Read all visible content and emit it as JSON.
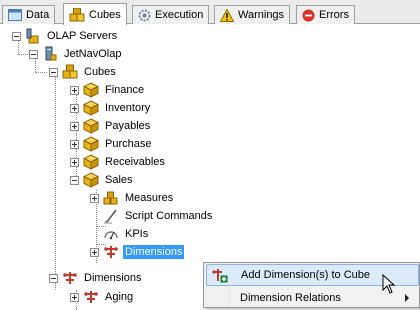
{
  "tabs": [
    {
      "label": "Data",
      "icon": "data-grid-icon",
      "active": false
    },
    {
      "label": "Cubes",
      "icon": "cubes-icon",
      "active": true
    },
    {
      "label": "Execution",
      "icon": "gear-icon",
      "active": false
    },
    {
      "label": "Warnings",
      "icon": "warning-icon",
      "active": false
    },
    {
      "label": "Errors",
      "icon": "error-icon",
      "active": false
    }
  ],
  "tree": {
    "olap_servers": "OLAP Servers",
    "server": "JetNavOlap",
    "cubes": "Cubes",
    "cube_items": [
      "Finance",
      "Inventory",
      "Payables",
      "Purchase",
      "Receivables"
    ],
    "sales": "Sales",
    "sales_children": {
      "measures": "Measures",
      "script_commands": "Script Commands",
      "kpis": "KPIs",
      "dimensions": "Dimensions"
    },
    "dimensions": "Dimensions",
    "aging": "Aging"
  },
  "context_menu": {
    "items": [
      {
        "label": "Add Dimension(s) to Cube",
        "icon": "add-dimension-icon",
        "hover": true
      },
      {
        "label": "Dimension Relations",
        "has_submenu": true
      }
    ]
  },
  "colors": {
    "selection": "#3399ff",
    "cube_gold": "#e8b317",
    "dimension_red": "#c0392b",
    "menu_hover": "#dcebfb"
  }
}
